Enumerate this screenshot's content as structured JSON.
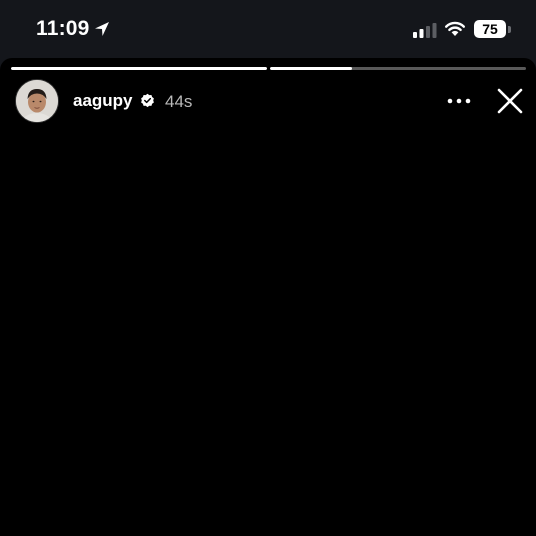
{
  "status_bar": {
    "time": "11:09",
    "battery": "75",
    "icons": [
      "location-arrow-icon",
      "cellular-signal-icon",
      "wifi-icon",
      "battery-icon"
    ]
  },
  "story": {
    "segments": [
      {
        "progress": 1.0
      },
      {
        "progress": 0.32
      }
    ],
    "user": {
      "username": "aagupy",
      "verified": true,
      "time_ago": "44s"
    },
    "icons": [
      "verified-badge-icon",
      "more-options-icon",
      "close-icon"
    ]
  }
}
